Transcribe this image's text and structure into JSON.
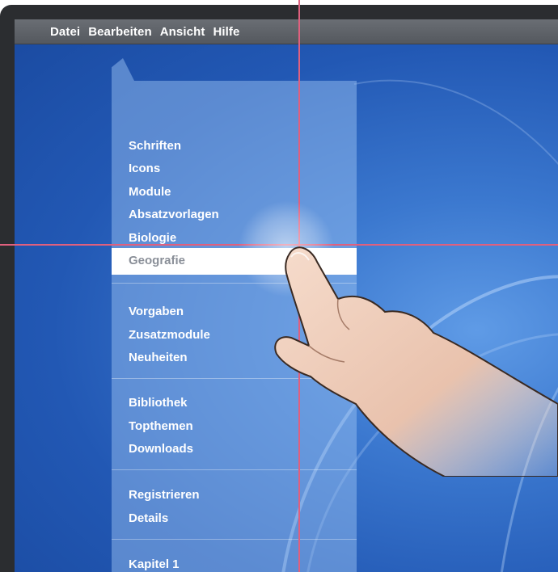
{
  "menubar": {
    "items": [
      {
        "label": "Datei"
      },
      {
        "label": "Bearbeiten"
      },
      {
        "label": "Ansicht"
      },
      {
        "label": "Hilfe"
      }
    ]
  },
  "menu": {
    "groups": [
      [
        "Schriften",
        "Icons",
        "Module",
        "Absatzvorlagen",
        "Biologie",
        "Geografie"
      ],
      [
        "Vorgaben",
        "Zusatzmodule",
        "Neuheiten"
      ],
      [
        "Bibliothek",
        "Topthemen",
        "Downloads"
      ],
      [
        "Registrieren",
        "Details"
      ],
      [
        "Kapitel 1"
      ]
    ],
    "selected": "Geografie"
  },
  "colors": {
    "screen": "#2258b4",
    "panel": "rgba(150,190,240,0.50)",
    "crosshair": "#e0607e",
    "menubar": "#5e6268"
  },
  "icons": {
    "pointer": "hand-pointer-icon"
  }
}
